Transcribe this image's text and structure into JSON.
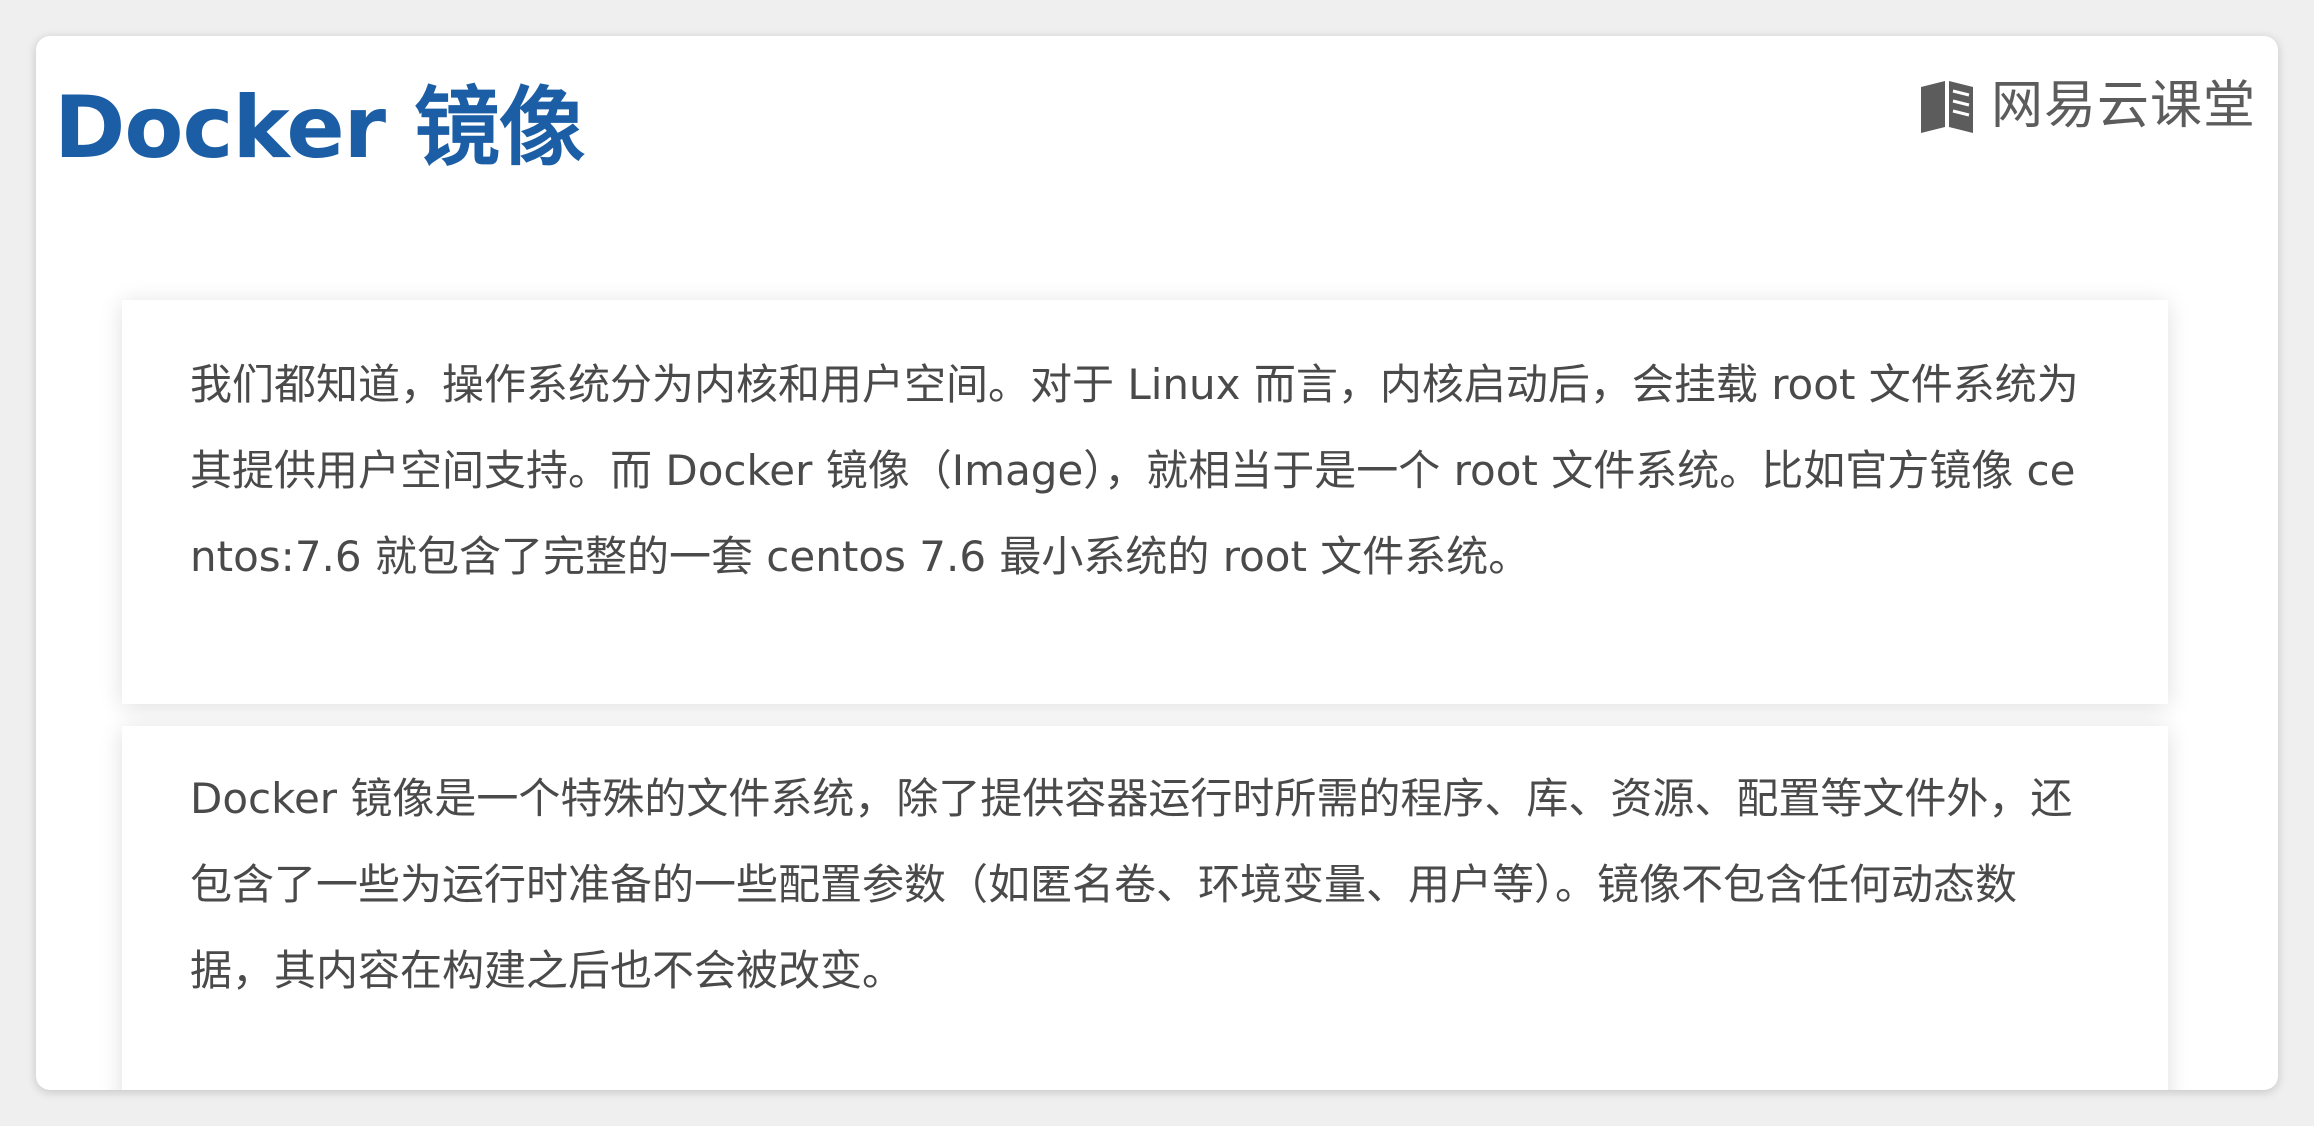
{
  "slide": {
    "title": "Docker 镜像",
    "brand": {
      "text": "网易云课堂",
      "icon": "book-icon",
      "color": "#5c5c5c"
    },
    "accent_color": "#1b5ea6",
    "paragraphs": [
      "我们都知道，操作系统分为内核和用户空间。对于 Linux 而言，内核启动后，会挂载 root 文件系统为其提供用户空间支持。而 Docker 镜像（Image），就相当于是一个 root 文件系统。比如官方镜像 centos:7.6 就包含了完整的一套 centos 7.6 最小系统的 root 文件系统。",
      "Docker 镜像是一个特殊的文件系统，除了提供容器运行时所需的程序、库、资源、配置等文件外，还包含了一些为运行时准备的一些配置参数（如匿名卷、环境变量、用户等）。镜像不包含任何动态数据，其内容在构建之后也不会被改变。"
    ]
  }
}
